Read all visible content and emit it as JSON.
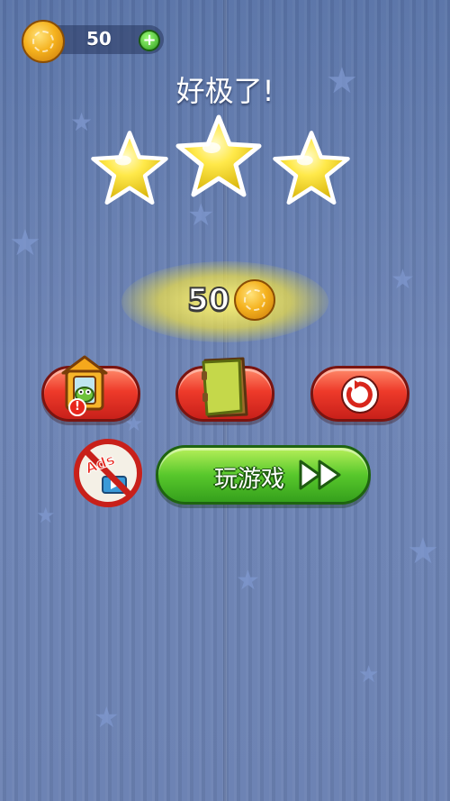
{
  "coin_bar": {
    "count": "50",
    "plus_symbol": "+"
  },
  "title": "好极了!",
  "stars_earned": 3,
  "reward": {
    "amount": "50"
  },
  "buttons": {
    "alert_mark": "!",
    "ads_label": "Ads",
    "play_label": "玩游戏"
  },
  "colors": {
    "background": "#6a81b2",
    "red_button": "#ee3a2a",
    "green_button": "#58c82c",
    "star_yellow": "#ffe94a",
    "coin_gold": "#f5b21e"
  }
}
